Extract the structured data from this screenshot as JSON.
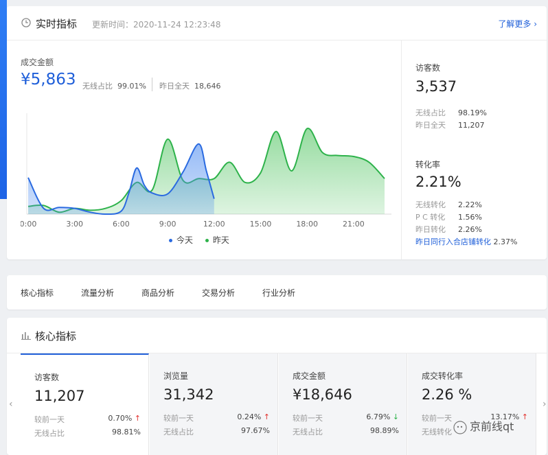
{
  "realtime": {
    "title": "实时指标",
    "update_time": "更新时间：2020-11-24 12:23:48",
    "more": "了解更多",
    "gmv": {
      "label": "成交金额",
      "value": "¥5,863",
      "mobile_label": "无线占比",
      "mobile_value": "99.01%",
      "yesterday_label": "昨日全天",
      "yesterday_value": "18,646"
    },
    "legend": {
      "today": "今天",
      "yesterday": "昨天"
    },
    "visitors": {
      "label": "访客数",
      "value": "3,537",
      "rows": [
        {
          "k": "无线占比",
          "v": "98.19%"
        },
        {
          "k": "昨日全天",
          "v": "11,207"
        }
      ]
    },
    "conversion": {
      "label": "转化率",
      "value": "2.21%",
      "rows": [
        {
          "k": "无线转化",
          "v": "2.22%"
        },
        {
          "k": "P C 转化",
          "v": "1.56%"
        },
        {
          "k": "昨日转化",
          "v": "2.26%"
        }
      ],
      "peer_link": "昨日同行入合店铺转化",
      "peer_value": "2.37%"
    }
  },
  "chart_data": {
    "type": "area",
    "x_ticks": [
      "0:00",
      "3:00",
      "6:00",
      "9:00",
      "12:00",
      "15:00",
      "18:00",
      "21:00"
    ],
    "x_range": [
      0,
      23
    ],
    "series": [
      {
        "name": "今天",
        "color": "#2a6ae0",
        "x": [
          0,
          1,
          2,
          3,
          4,
          5,
          6,
          6.5,
          7,
          7.5,
          8,
          9,
          10,
          11,
          11.5,
          12
        ],
        "y": [
          0.38,
          0.06,
          0.07,
          0.06,
          0.02,
          0.0,
          0.03,
          0.22,
          0.48,
          0.3,
          0.22,
          0.21,
          0.44,
          0.73,
          0.45,
          0.16
        ]
      },
      {
        "name": "昨天",
        "color": "#2db24a",
        "x": [
          0,
          1,
          2,
          3,
          4,
          5,
          6,
          7,
          8,
          9,
          10,
          11,
          12,
          13,
          14,
          15,
          16,
          17,
          18,
          19,
          20,
          21,
          22,
          23
        ],
        "y": [
          0.08,
          0.09,
          0.02,
          0.06,
          0.04,
          0.06,
          0.14,
          0.33,
          0.25,
          0.78,
          0.35,
          0.37,
          0.37,
          0.54,
          0.33,
          0.43,
          0.86,
          0.45,
          0.89,
          0.64,
          0.61,
          0.6,
          0.54,
          0.37
        ]
      }
    ]
  },
  "tabs": [
    "核心指标",
    "流量分析",
    "商品分析",
    "交易分析",
    "行业分析"
  ],
  "core": {
    "title": "核心指标",
    "metrics": [
      {
        "label": "访客数",
        "value": "11,207",
        "cmp_label": "较前一天",
        "cmp_value": "0.70%",
        "trend": "up",
        "mob_label": "无线占比",
        "mob_value": "98.81%"
      },
      {
        "label": "浏览量",
        "value": "31,342",
        "cmp_label": "较前一天",
        "cmp_value": "0.24%",
        "trend": "up",
        "mob_label": "无线占比",
        "mob_value": "97.67%"
      },
      {
        "label": "成交金额",
        "value": "¥18,646",
        "cmp_label": "较前一天",
        "cmp_value": "6.79%",
        "trend": "down",
        "mob_label": "无线占比",
        "mob_value": "98.89%"
      },
      {
        "label": "成交转化率",
        "value": "2.26 %",
        "cmp_label": "较前一天",
        "cmp_value": "13.17%",
        "trend": "up",
        "mob_label": "无线转化",
        "mob_value": ""
      }
    ]
  },
  "arrows": {
    "up": "↑",
    "down": "↓",
    "prev": "‹",
    "next": "›"
  },
  "watermark": "京前线qt"
}
